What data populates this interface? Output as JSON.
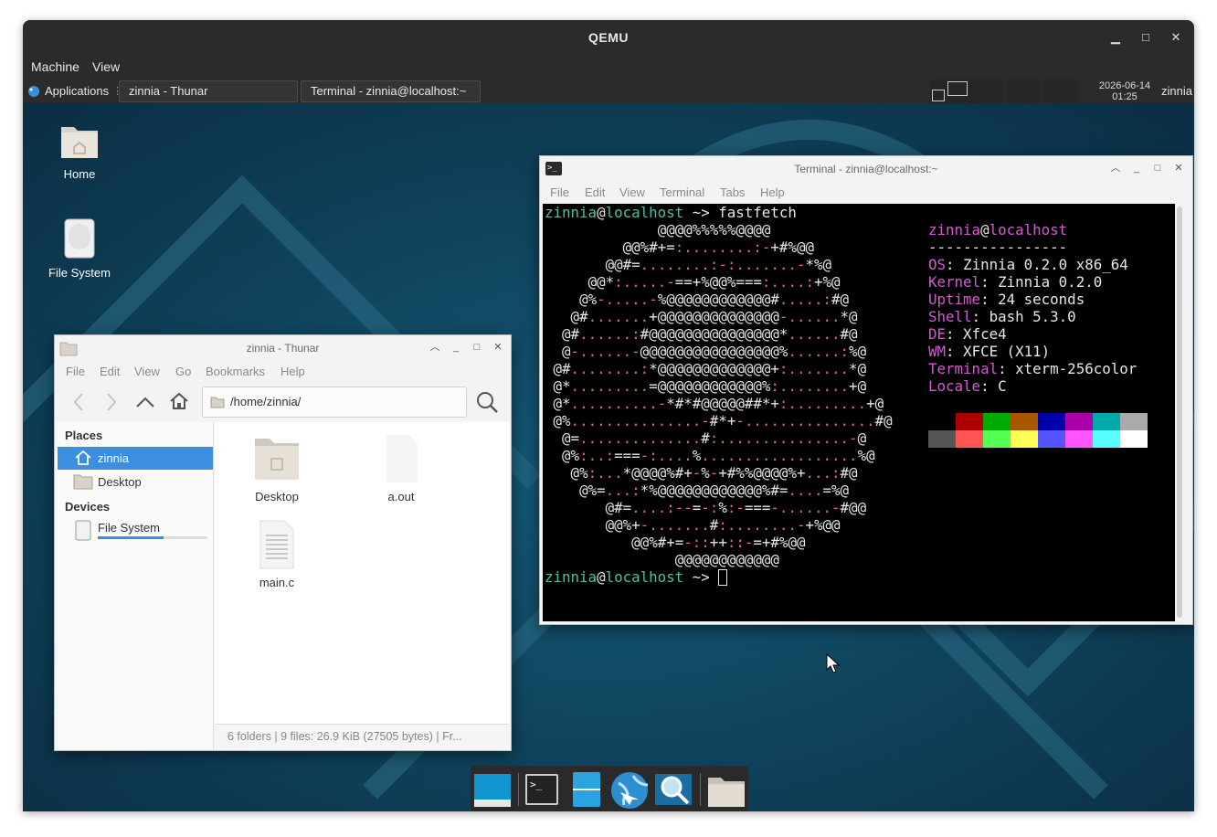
{
  "qemu": {
    "title": "QEMU",
    "menu": [
      "Machine",
      "View"
    ],
    "controls": {
      "minimize": "▁",
      "maximize": "□",
      "close": "✕"
    }
  },
  "panel": {
    "applications": "Applications",
    "tasks": [
      "zinnia - Thunar",
      "Terminal - zinnia@localhost:~"
    ],
    "date": "2026-06-14",
    "time": "01:25",
    "user": "zinnia"
  },
  "desktop_icons": [
    "Home",
    "File System"
  ],
  "terminal": {
    "title": "Terminal - zinnia@localhost:~",
    "menu": [
      "File",
      "Edit",
      "View",
      "Terminal",
      "Tabs",
      "Help"
    ],
    "prompt_user": "zinnia",
    "prompt_at": "@",
    "prompt_host": "localhost",
    "prompt_suffix": " ~> ",
    "command": "fastfetch",
    "ascii_art": [
      "             @@@@%%%%%@@@@",
      "         @@%#+=:........:-+#%@@",
      "       @@#=........:-:.......-*%@",
      "     @@*:.....-==+%@@%===:....:+%@",
      "    @%-.....-%@@@@@@@@@@@@#.....:#@",
      "   @#.......+@@@@@@@@@@@@@@-......*@",
      "  @#......:#@@@@@@@@@@@@@@@*......#@",
      "  @-......-@@@@@@@@@@@@@@@@%......:%@",
      " @#........:*@@@@@@@@@@@@@+:.......*@",
      " @*.........=@@@@@@@@@@@@%:........+@",
      " @*..........-*#*#@@@@@##*+:.........+@",
      " @%...............-#*+-...............#@",
      "  @=..............#:...............-@",
      "  @%:..:===-:....%..................%@",
      "   @%:...*@@@@%#+-%-+#%%@@@@%+...:#@",
      "    @%=...:*%@@@@@@@@@@@@%#=....=%@",
      "       @#=....:--=-:%:-===-......-#@@",
      "       @@%+-.......#:........-+%@@",
      "          @@%#+=-::++::-=+#%@@",
      "               @@@@@@@@@@@@"
    ],
    "info_title_user": "zinnia",
    "info_title_at": "@",
    "info_title_host": "localhost",
    "info_separator": "----------------",
    "info": [
      {
        "key": "OS",
        "value": "Zinnia 0.2.0 x86_64"
      },
      {
        "key": "Kernel",
        "value": "Zinnia 0.2.0"
      },
      {
        "key": "Uptime",
        "value": "24 seconds"
      },
      {
        "key": "Shell",
        "value": "bash 5.3.0"
      },
      {
        "key": "DE",
        "value": "Xfce4"
      },
      {
        "key": "WM",
        "value": "XFCE (X11)"
      },
      {
        "key": "Terminal",
        "value": "xterm-256color"
      },
      {
        "key": "Locale",
        "value": "C"
      }
    ],
    "palette_top": [
      "#000000",
      "#aa0000",
      "#00aa00",
      "#aa5500",
      "#0000aa",
      "#aa00aa",
      "#00aaaa",
      "#aaaaaa"
    ],
    "palette_bottom": [
      "#555555",
      "#ff5555",
      "#55ff55",
      "#ffff55",
      "#5555ff",
      "#ff55ff",
      "#55ffff",
      "#ffffff"
    ]
  },
  "thunar": {
    "title": "zinnia - Thunar",
    "menu": [
      "File",
      "Edit",
      "View",
      "Go",
      "Bookmarks",
      "Help"
    ],
    "location": "/home/zinnia/",
    "places_header": "Places",
    "places": [
      "zinnia",
      "Desktop"
    ],
    "devices_header": "Devices",
    "devices": [
      "File System"
    ],
    "disk_usage": 0.6,
    "files": [
      "Desktop",
      "a.out",
      "main.c"
    ],
    "status": "6 folders  |  9 files: 26.9 KiB (27505 bytes)  |  Fr..."
  },
  "dock": [
    "terminal-icon",
    "files-icon",
    "browser-icon",
    "search-icon",
    "folder-icon"
  ]
}
